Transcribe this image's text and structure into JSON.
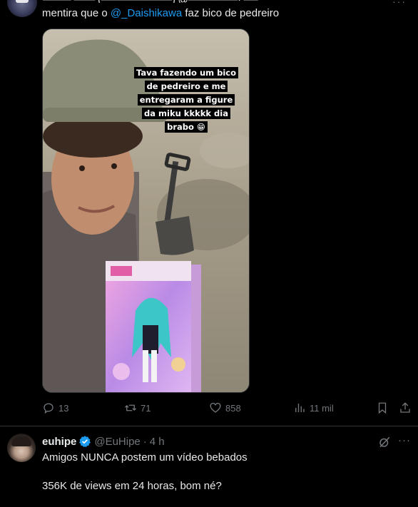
{
  "tweet1": {
    "header_cut": "──── ─── (──────────) @───────· ──",
    "more": "···",
    "text_before": "mentira que o ",
    "mention": "@_Daishikawa",
    "text_after": " faz bico de pedreiro",
    "media": {
      "caption": "Tava fazendo um bico de pedreiro e me entregaram a figure da miku kkkkk dia brabo 😁"
    },
    "actions": {
      "replies": "13",
      "reposts": "71",
      "likes": "858",
      "views": "11 mil"
    }
  },
  "tweet2": {
    "name": "euhipe",
    "handle": "@EuHipe",
    "dot": "·",
    "time": "4 h",
    "more": "···",
    "lines": [
      "Amigos NUNCA postem um vídeo bebados",
      "356K de views em 24 horas, bom né?"
    ]
  },
  "colors": {
    "background": "#000000",
    "text": "#e7e9ea",
    "muted": "#71767b",
    "accent": "#1d9bf0",
    "divider": "#2f3336"
  },
  "icons": [
    "reply-icon",
    "repost-icon",
    "like-icon",
    "views-icon",
    "bookmark-icon",
    "share-icon",
    "verified-badge-icon",
    "grok-icon"
  ]
}
